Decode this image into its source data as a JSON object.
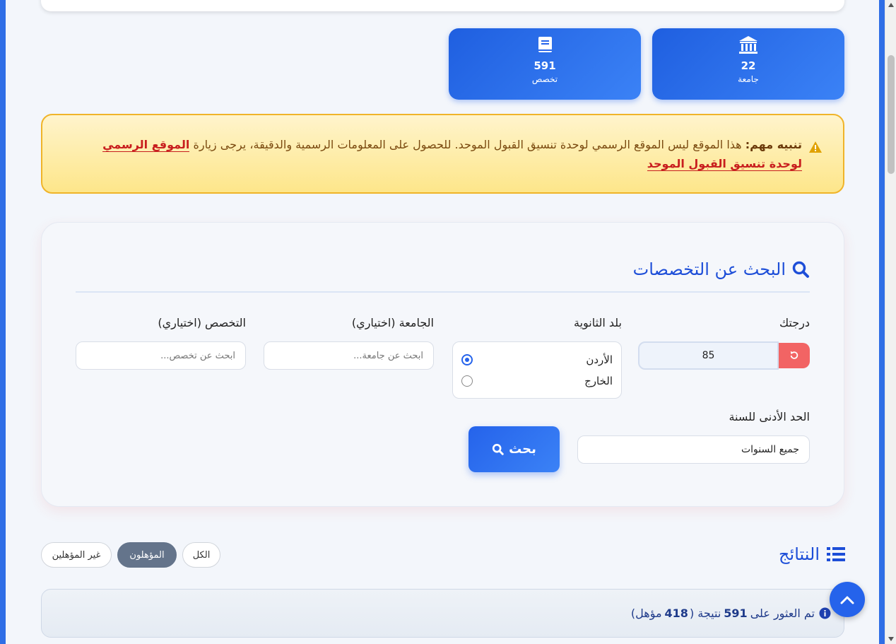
{
  "stats": {
    "universities": {
      "count": "22",
      "label": "جامعة",
      "icon": "bank-icon"
    },
    "majors": {
      "count": "591",
      "label": "تخصص",
      "icon": "book-icon"
    }
  },
  "alert": {
    "title": "تنبيه مهم:",
    "text": " هذا الموقع ليس الموقع الرسمي لوحدة تنسيق القبول الموحد. للحصول على المعلومات الرسمية والدقيقة، يرجى زيارة ",
    "link": "الموقع الرسمي لوحدة تنسيق القبول الموحد"
  },
  "search": {
    "title": "البحث عن التخصصات",
    "grade_label": "درجتك",
    "grade_value": "85",
    "country_label": "بلد الثانوية",
    "country_options": [
      "الأردن",
      "الخارج"
    ],
    "country_selected": "الأردن",
    "university_label": "الجامعة (اختياري)",
    "university_placeholder": "ابحث عن جامعة...",
    "major_label": "التخصص (اختياري)",
    "major_placeholder": "ابحث عن تخصص...",
    "year_label": "الحد الأدنى للسنة",
    "year_value": "جميع السنوات",
    "search_button": "بحث"
  },
  "results": {
    "title": "النتائج",
    "filters": [
      "الكل",
      "المؤهلون",
      "غير المؤهلين"
    ],
    "active_filter": "المؤهلون",
    "summary_prefix": "تم العثور على",
    "total": "591",
    "summary_mid": "نتيجة (",
    "qualified": "418",
    "summary_suffix": "مؤهل)"
  },
  "colors": {
    "primary": "#2563eb",
    "warning_border": "#f0b429",
    "reset": "#f26464",
    "link": "#c81e1e"
  }
}
